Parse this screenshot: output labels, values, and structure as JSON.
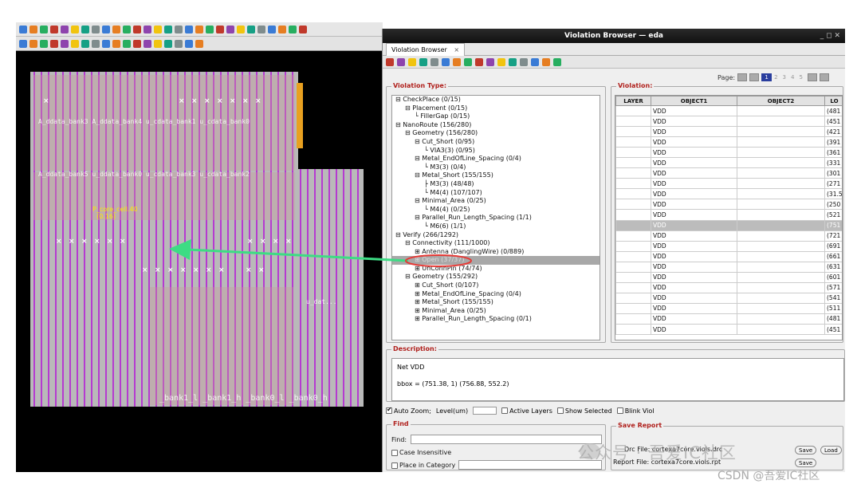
{
  "window": {
    "title": "Violation Browser — eda",
    "controls": "_ ◻ ✕",
    "tab_label": "Violation Browser",
    "tab_close": "×"
  },
  "layout_view": {
    "row_labels_top": [
      "A_ddata_bank3 A_ddata_bank4 u_cdata_bank1 u_cdata_bank0"
    ],
    "row_labels_mid": [
      "A_ddata_bank5 u_ddata_bank0 u_cdata_bank3 u_cdata_bank2"
    ],
    "row_labels_bot": [
      "_bank1_l _bank1_h _bank0_l _bank0_h"
    ],
    "right_label": "u_dat...",
    "yellow_label": "P_core_cell.40\n  (0.16)"
  },
  "violation_type": {
    "group_label": "Violation Type:",
    "tree": [
      {
        "level": 0,
        "sign": "⊟",
        "text": "CheckPlace (0/15)"
      },
      {
        "level": 1,
        "sign": "⊟",
        "text": "Placement (0/15)"
      },
      {
        "level": 2,
        "sign": "└",
        "text": "FillerGap (0/15)"
      },
      {
        "level": 0,
        "sign": "⊟",
        "text": "NanoRoute (156/280)"
      },
      {
        "level": 1,
        "sign": "⊟",
        "text": "Geometry (156/280)"
      },
      {
        "level": 2,
        "sign": "⊟",
        "text": "Cut_Short (0/95)"
      },
      {
        "level": 3,
        "sign": "└",
        "text": "VIA3(3) (0/95)"
      },
      {
        "level": 2,
        "sign": "⊟",
        "text": "Metal_EndOfLine_Spacing (0/4)"
      },
      {
        "level": 3,
        "sign": "└",
        "text": "M3(3) (0/4)"
      },
      {
        "level": 2,
        "sign": "⊟",
        "text": "Metal_Short (155/155)"
      },
      {
        "level": 3,
        "sign": "├",
        "text": "M3(3) (48/48)"
      },
      {
        "level": 3,
        "sign": "└",
        "text": "M4(4) (107/107)"
      },
      {
        "level": 2,
        "sign": "⊟",
        "text": "Minimal_Area (0/25)"
      },
      {
        "level": 3,
        "sign": "└",
        "text": "M4(4) (0/25)"
      },
      {
        "level": 2,
        "sign": "⊟",
        "text": "Parallel_Run_Length_Spacing (1/1)"
      },
      {
        "level": 3,
        "sign": "└",
        "text": "M6(6) (1/1)"
      },
      {
        "level": 0,
        "sign": "⊟",
        "text": "Verify (266/1292)"
      },
      {
        "level": 1,
        "sign": "⊟",
        "text": "Connectivity (111/1000)"
      },
      {
        "level": 2,
        "sign": "⊞",
        "text": "Antenna (DanglingWire) (0/889)"
      },
      {
        "level": 2,
        "sign": "⊞",
        "text": "Open (37/37)",
        "highlight": true
      },
      {
        "level": 2,
        "sign": "⊞",
        "text": "UnConnPin (74/74)"
      },
      {
        "level": 1,
        "sign": "⊟",
        "text": "Geometry (155/292)"
      },
      {
        "level": 2,
        "sign": "⊞",
        "text": "Cut_Short (0/107)"
      },
      {
        "level": 2,
        "sign": "⊞",
        "text": "Metal_EndOfLine_Spacing (0/4)"
      },
      {
        "level": 2,
        "sign": "⊞",
        "text": "Metal_Short (155/155)"
      },
      {
        "level": 2,
        "sign": "⊞",
        "text": "Minimal_Area (0/25)"
      },
      {
        "level": 2,
        "sign": "⊞",
        "text": "Parallel_Run_Length_Spacing (0/1)"
      }
    ]
  },
  "violation": {
    "group_label": "Violation:",
    "pager_label": "Page:",
    "pages": [
      "1",
      "2",
      "3",
      "4",
      "5"
    ],
    "current_page": "1",
    "columns": [
      "LAYER",
      "OBJECT1",
      "OBJECT2",
      "LO"
    ],
    "rows": [
      {
        "layer": "",
        "obj1": "VDD",
        "obj2": "",
        "loc": "(481"
      },
      {
        "layer": "",
        "obj1": "VDD",
        "obj2": "",
        "loc": "(451"
      },
      {
        "layer": "",
        "obj1": "VDD",
        "obj2": "",
        "loc": "(421"
      },
      {
        "layer": "",
        "obj1": "VDD",
        "obj2": "",
        "loc": "(391"
      },
      {
        "layer": "",
        "obj1": "VDD",
        "obj2": "",
        "loc": "(361"
      },
      {
        "layer": "",
        "obj1": "VDD",
        "obj2": "",
        "loc": "(331"
      },
      {
        "layer": "",
        "obj1": "VDD",
        "obj2": "",
        "loc": "(301"
      },
      {
        "layer": "",
        "obj1": "VDD",
        "obj2": "",
        "loc": "(271"
      },
      {
        "layer": "",
        "obj1": "VDD",
        "obj2": "",
        "loc": "(31.5"
      },
      {
        "layer": "",
        "obj1": "VDD",
        "obj2": "",
        "loc": "(250"
      },
      {
        "layer": "",
        "obj1": "VDD",
        "obj2": "",
        "loc": "(521"
      },
      {
        "layer": "",
        "obj1": "VDD",
        "obj2": "",
        "loc": "(751",
        "selected": true
      },
      {
        "layer": "",
        "obj1": "VDD",
        "obj2": "",
        "loc": "(721"
      },
      {
        "layer": "",
        "obj1": "VDD",
        "obj2": "",
        "loc": "(691"
      },
      {
        "layer": "",
        "obj1": "VDD",
        "obj2": "",
        "loc": "(661"
      },
      {
        "layer": "",
        "obj1": "VDD",
        "obj2": "",
        "loc": "(631"
      },
      {
        "layer": "",
        "obj1": "VDD",
        "obj2": "",
        "loc": "(601"
      },
      {
        "layer": "",
        "obj1": "VDD",
        "obj2": "",
        "loc": "(571"
      },
      {
        "layer": "",
        "obj1": "VDD",
        "obj2": "",
        "loc": "(541"
      },
      {
        "layer": "",
        "obj1": "VDD",
        "obj2": "",
        "loc": "(511"
      },
      {
        "layer": "",
        "obj1": "VDD",
        "obj2": "",
        "loc": "(481"
      },
      {
        "layer": "",
        "obj1": "VDD",
        "obj2": "",
        "loc": "(451"
      }
    ]
  },
  "description": {
    "group_label": "Description:",
    "line1": "Net VDD",
    "line2": "bbox = (751.38, 1) (756.88, 552.2)"
  },
  "options": {
    "auto_zoom": "Auto Zoom;",
    "level": "Level(um)",
    "active_layers": "Active Layers",
    "show_selected": "Show Selected",
    "blink_viol": "Blink Viol"
  },
  "find": {
    "group_label": "Find",
    "find_label": "Find:",
    "case_insensitive": "Case Insensitive",
    "place_in_category": "Place in Category"
  },
  "save_report": {
    "group_label": "Save Report",
    "drc_label": "Drc File:",
    "drc_value": "cortexa7core.viols.drc",
    "report_label": "Report File:",
    "report_value": "cortexa7core.viols.rpt",
    "save_btn": "Save",
    "load_btn": "Load"
  },
  "watermark": {
    "text": "公众号 · 吾爱IC社区",
    "csdn": "CSDN @吾爱IC社区"
  },
  "colors": {
    "highlight_ellipse": "#e53935",
    "arrow": "#3ddc84",
    "stripe": "#b53bd0",
    "group_label": "#b0201c"
  }
}
